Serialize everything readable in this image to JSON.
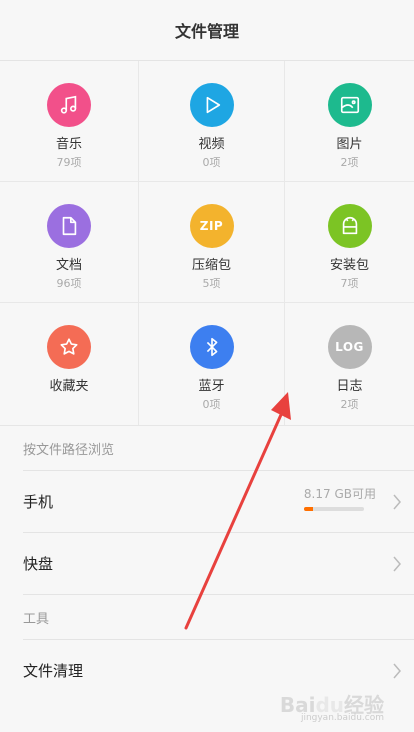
{
  "header": {
    "title": "文件管理"
  },
  "categories": [
    {
      "label": "音乐",
      "count": "79项",
      "color": "#f2508a",
      "icon": "music-note-icon"
    },
    {
      "label": "视频",
      "count": "0项",
      "color": "#1ea6e3",
      "icon": "play-icon"
    },
    {
      "label": "图片",
      "count": "2项",
      "color": "#1dba8e",
      "icon": "image-icon"
    },
    {
      "label": "文档",
      "count": "96项",
      "color": "#9b6fe0",
      "icon": "document-icon"
    },
    {
      "label": "压缩包",
      "count": "5项",
      "color": "#f3b32d",
      "icon": "zip-icon",
      "icon_text": "ZIP"
    },
    {
      "label": "安装包",
      "count": "7项",
      "color": "#7cc424",
      "icon": "android-icon"
    },
    {
      "label": "收藏夹",
      "count": "",
      "color": "#f46c55",
      "icon": "star-icon"
    },
    {
      "label": "蓝牙",
      "count": "0项",
      "color": "#3d7ff0",
      "icon": "bluetooth-icon"
    },
    {
      "label": "日志",
      "count": "2项",
      "color": "#b7b7b7",
      "icon": "log-icon",
      "icon_text": "LOG"
    }
  ],
  "browse": {
    "section_title": "按文件路径浏览",
    "phone_label": "手机",
    "storage_text": "8.17 GB可用",
    "storage_used_fraction": 0.15,
    "kuaipan_label": "快盘"
  },
  "tools": {
    "section_title": "工具",
    "cleanup_label": "文件清理"
  },
  "colors": {
    "annotation_arrow": "#e8413e"
  }
}
